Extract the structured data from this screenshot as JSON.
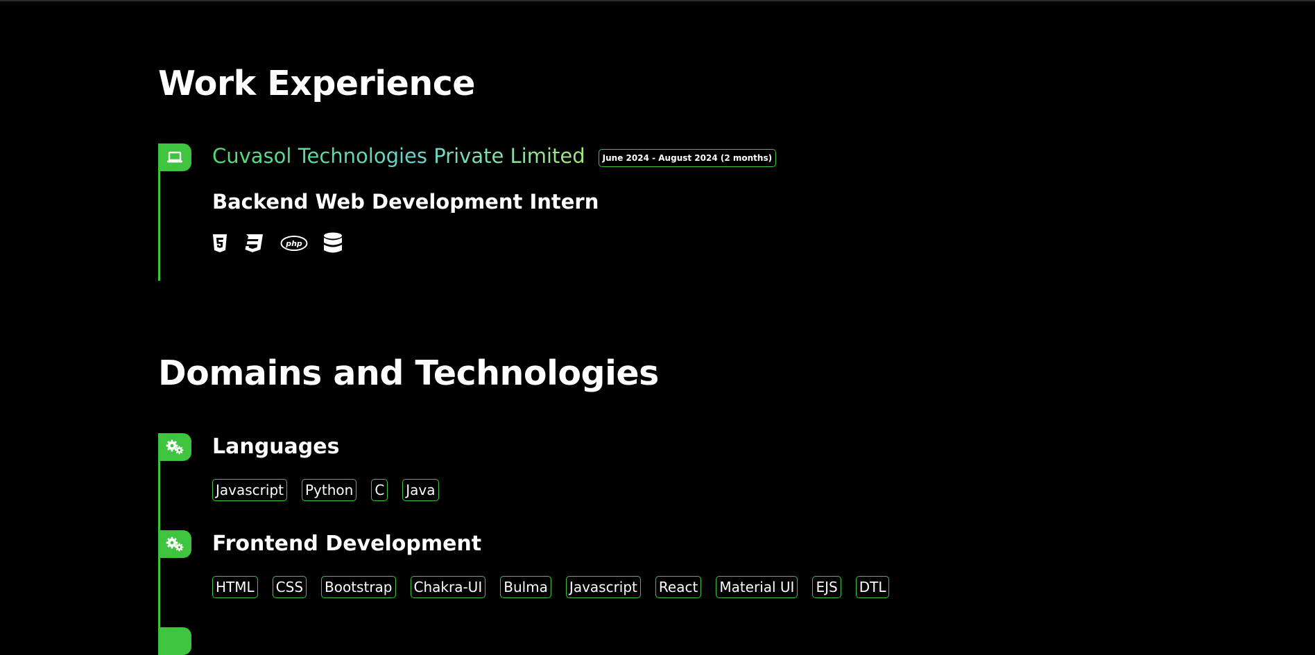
{
  "work": {
    "title": "Work Experience",
    "company": "Cuvasol Technologies Private Limited",
    "duration": "June 2024 - August 2024 (2 months)",
    "role": "Backend Web Development Intern",
    "icon": "laptop-icon",
    "tech_icons": [
      "html5-icon",
      "css3-icon",
      "php-icon",
      "database-icon"
    ],
    "accent_color": "#3ec43e"
  },
  "domains": {
    "title": "Domains and Technologies",
    "languages": {
      "title": "Languages",
      "icon": "gears-icon",
      "tags": [
        "Javascript",
        "Python",
        "C",
        "Java"
      ]
    },
    "frontend": {
      "title": "Frontend Development",
      "icon": "gears-icon",
      "tags": [
        "HTML",
        "CSS",
        "Bootstrap",
        "Chakra-UI",
        "Bulma",
        "Javascript",
        "React",
        "Material UI",
        "EJS",
        "DTL"
      ]
    }
  }
}
